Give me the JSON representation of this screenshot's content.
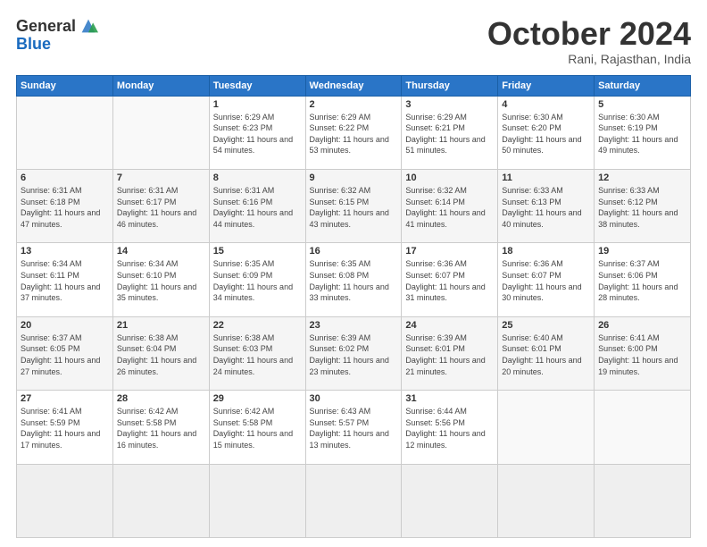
{
  "logo": {
    "general": "General",
    "blue": "Blue"
  },
  "header": {
    "month": "October 2024",
    "location": "Rani, Rajasthan, India"
  },
  "weekdays": [
    "Sunday",
    "Monday",
    "Tuesday",
    "Wednesday",
    "Thursday",
    "Friday",
    "Saturday"
  ],
  "days": [
    {
      "date": "",
      "info": ""
    },
    {
      "date": "",
      "info": ""
    },
    {
      "date": "1",
      "info": "Sunrise: 6:29 AM\nSunset: 6:23 PM\nDaylight: 11 hours and 54 minutes."
    },
    {
      "date": "2",
      "info": "Sunrise: 6:29 AM\nSunset: 6:22 PM\nDaylight: 11 hours and 53 minutes."
    },
    {
      "date": "3",
      "info": "Sunrise: 6:29 AM\nSunset: 6:21 PM\nDaylight: 11 hours and 51 minutes."
    },
    {
      "date": "4",
      "info": "Sunrise: 6:30 AM\nSunset: 6:20 PM\nDaylight: 11 hours and 50 minutes."
    },
    {
      "date": "5",
      "info": "Sunrise: 6:30 AM\nSunset: 6:19 PM\nDaylight: 11 hours and 49 minutes."
    },
    {
      "date": "6",
      "info": "Sunrise: 6:31 AM\nSunset: 6:18 PM\nDaylight: 11 hours and 47 minutes."
    },
    {
      "date": "7",
      "info": "Sunrise: 6:31 AM\nSunset: 6:17 PM\nDaylight: 11 hours and 46 minutes."
    },
    {
      "date": "8",
      "info": "Sunrise: 6:31 AM\nSunset: 6:16 PM\nDaylight: 11 hours and 44 minutes."
    },
    {
      "date": "9",
      "info": "Sunrise: 6:32 AM\nSunset: 6:15 PM\nDaylight: 11 hours and 43 minutes."
    },
    {
      "date": "10",
      "info": "Sunrise: 6:32 AM\nSunset: 6:14 PM\nDaylight: 11 hours and 41 minutes."
    },
    {
      "date": "11",
      "info": "Sunrise: 6:33 AM\nSunset: 6:13 PM\nDaylight: 11 hours and 40 minutes."
    },
    {
      "date": "12",
      "info": "Sunrise: 6:33 AM\nSunset: 6:12 PM\nDaylight: 11 hours and 38 minutes."
    },
    {
      "date": "13",
      "info": "Sunrise: 6:34 AM\nSunset: 6:11 PM\nDaylight: 11 hours and 37 minutes."
    },
    {
      "date": "14",
      "info": "Sunrise: 6:34 AM\nSunset: 6:10 PM\nDaylight: 11 hours and 35 minutes."
    },
    {
      "date": "15",
      "info": "Sunrise: 6:35 AM\nSunset: 6:09 PM\nDaylight: 11 hours and 34 minutes."
    },
    {
      "date": "16",
      "info": "Sunrise: 6:35 AM\nSunset: 6:08 PM\nDaylight: 11 hours and 33 minutes."
    },
    {
      "date": "17",
      "info": "Sunrise: 6:36 AM\nSunset: 6:07 PM\nDaylight: 11 hours and 31 minutes."
    },
    {
      "date": "18",
      "info": "Sunrise: 6:36 AM\nSunset: 6:07 PM\nDaylight: 11 hours and 30 minutes."
    },
    {
      "date": "19",
      "info": "Sunrise: 6:37 AM\nSunset: 6:06 PM\nDaylight: 11 hours and 28 minutes."
    },
    {
      "date": "20",
      "info": "Sunrise: 6:37 AM\nSunset: 6:05 PM\nDaylight: 11 hours and 27 minutes."
    },
    {
      "date": "21",
      "info": "Sunrise: 6:38 AM\nSunset: 6:04 PM\nDaylight: 11 hours and 26 minutes."
    },
    {
      "date": "22",
      "info": "Sunrise: 6:38 AM\nSunset: 6:03 PM\nDaylight: 11 hours and 24 minutes."
    },
    {
      "date": "23",
      "info": "Sunrise: 6:39 AM\nSunset: 6:02 PM\nDaylight: 11 hours and 23 minutes."
    },
    {
      "date": "24",
      "info": "Sunrise: 6:39 AM\nSunset: 6:01 PM\nDaylight: 11 hours and 21 minutes."
    },
    {
      "date": "25",
      "info": "Sunrise: 6:40 AM\nSunset: 6:01 PM\nDaylight: 11 hours and 20 minutes."
    },
    {
      "date": "26",
      "info": "Sunrise: 6:41 AM\nSunset: 6:00 PM\nDaylight: 11 hours and 19 minutes."
    },
    {
      "date": "27",
      "info": "Sunrise: 6:41 AM\nSunset: 5:59 PM\nDaylight: 11 hours and 17 minutes."
    },
    {
      "date": "28",
      "info": "Sunrise: 6:42 AM\nSunset: 5:58 PM\nDaylight: 11 hours and 16 minutes."
    },
    {
      "date": "29",
      "info": "Sunrise: 6:42 AM\nSunset: 5:58 PM\nDaylight: 11 hours and 15 minutes."
    },
    {
      "date": "30",
      "info": "Sunrise: 6:43 AM\nSunset: 5:57 PM\nDaylight: 11 hours and 13 minutes."
    },
    {
      "date": "31",
      "info": "Sunrise: 6:44 AM\nSunset: 5:56 PM\nDaylight: 11 hours and 12 minutes."
    },
    {
      "date": "",
      "info": ""
    },
    {
      "date": "",
      "info": ""
    },
    {
      "date": "",
      "info": ""
    }
  ]
}
